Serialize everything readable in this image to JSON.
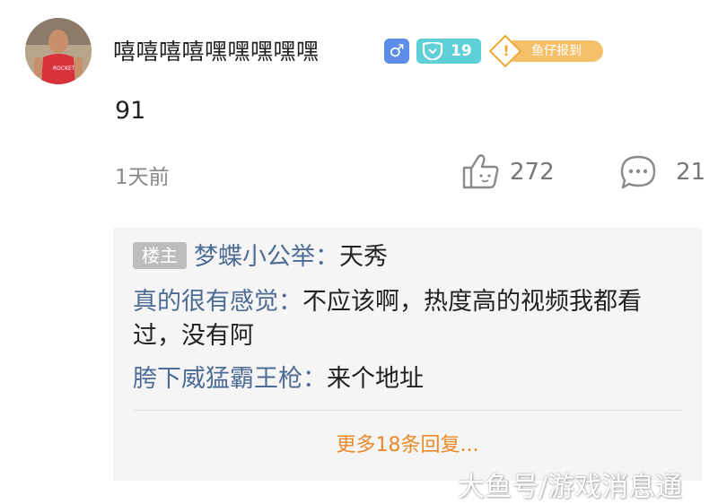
{
  "post": {
    "username": "嘻嘻嘻嘻嘿嘿嘿嘿嘿",
    "gender_symbol": "♂",
    "level": "19",
    "report_badge": "鱼仔报到",
    "content": "91",
    "timestamp": "1天前",
    "likes": "272",
    "comments": "21"
  },
  "replies": {
    "host_tag": "楼主",
    "items": [
      {
        "name": "梦蝶小公举",
        "sep": "：",
        "text": "天秀"
      },
      {
        "name": "真的很有感觉",
        "sep": "：",
        "text": "不应该啊，热度高的视频我都看过，没有阿"
      },
      {
        "name": "胯下威猛霸王枪",
        "sep": "：",
        "text": "来个地址"
      }
    ],
    "more_label": "更多18条回复..."
  },
  "watermark": "大鱼号/游戏消息通",
  "colors": {
    "name_blue": "#4d6c95",
    "more_orange": "#e9892a",
    "level_teal": "#5fd0d8",
    "gender_blue": "#5d8de8",
    "report_gold": "#f5c06a"
  },
  "icons": [
    "avatar",
    "male-icon",
    "level-shield-icon",
    "report-diamond-icon",
    "thumbs-up-icon",
    "comment-bubble-icon"
  ]
}
